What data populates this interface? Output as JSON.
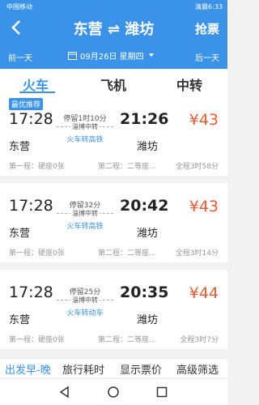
{
  "status": {
    "carrier": "中国移动",
    "right": "清晨6:33"
  },
  "header": {
    "title": "东营 ⇌ 潍坊",
    "grab": "抢票",
    "prev_day": "前一天",
    "next_day": "后一天",
    "date": "09月26日 星期四"
  },
  "tabs": [
    "火车",
    "飞机",
    "中转"
  ],
  "cards": [
    {
      "badge": "最优推荐",
      "dep": "17:28",
      "arr": "21:26",
      "stop": "停留1时10分",
      "transfer": "淄博中转",
      "mode": "火车转高铁",
      "from": "东营",
      "to": "潍坊",
      "price": "¥43",
      "leg1": "第一程：硬座0张",
      "leg2": "第二程：二等座...",
      "total": "全程3时58分"
    },
    {
      "badge": "",
      "dep": "17:28",
      "arr": "20:42",
      "stop": "停留32分",
      "transfer": "淄博中转",
      "mode": "火车转高铁",
      "from": "东营",
      "to": "潍坊",
      "price": "¥43",
      "leg1": "第一程：硬座0张",
      "leg2": "第二程：二等座...",
      "total": "全程3时14分"
    },
    {
      "badge": "",
      "dep": "17:28",
      "arr": "20:35",
      "stop": "停留25分",
      "transfer": "淄博中转",
      "mode": "火车转动车",
      "from": "东营",
      "to": "潍坊",
      "price": "¥44",
      "leg1": "第一程：硬座0张",
      "leg2": "第二程：二等座...",
      "total": "全程3时7分"
    }
  ],
  "bottom": [
    "出发早-晚",
    "旅行耗时",
    "显示票价",
    "高级筛选"
  ],
  "colors": {
    "primary": "#3a93e8",
    "price": "#f05a32"
  }
}
